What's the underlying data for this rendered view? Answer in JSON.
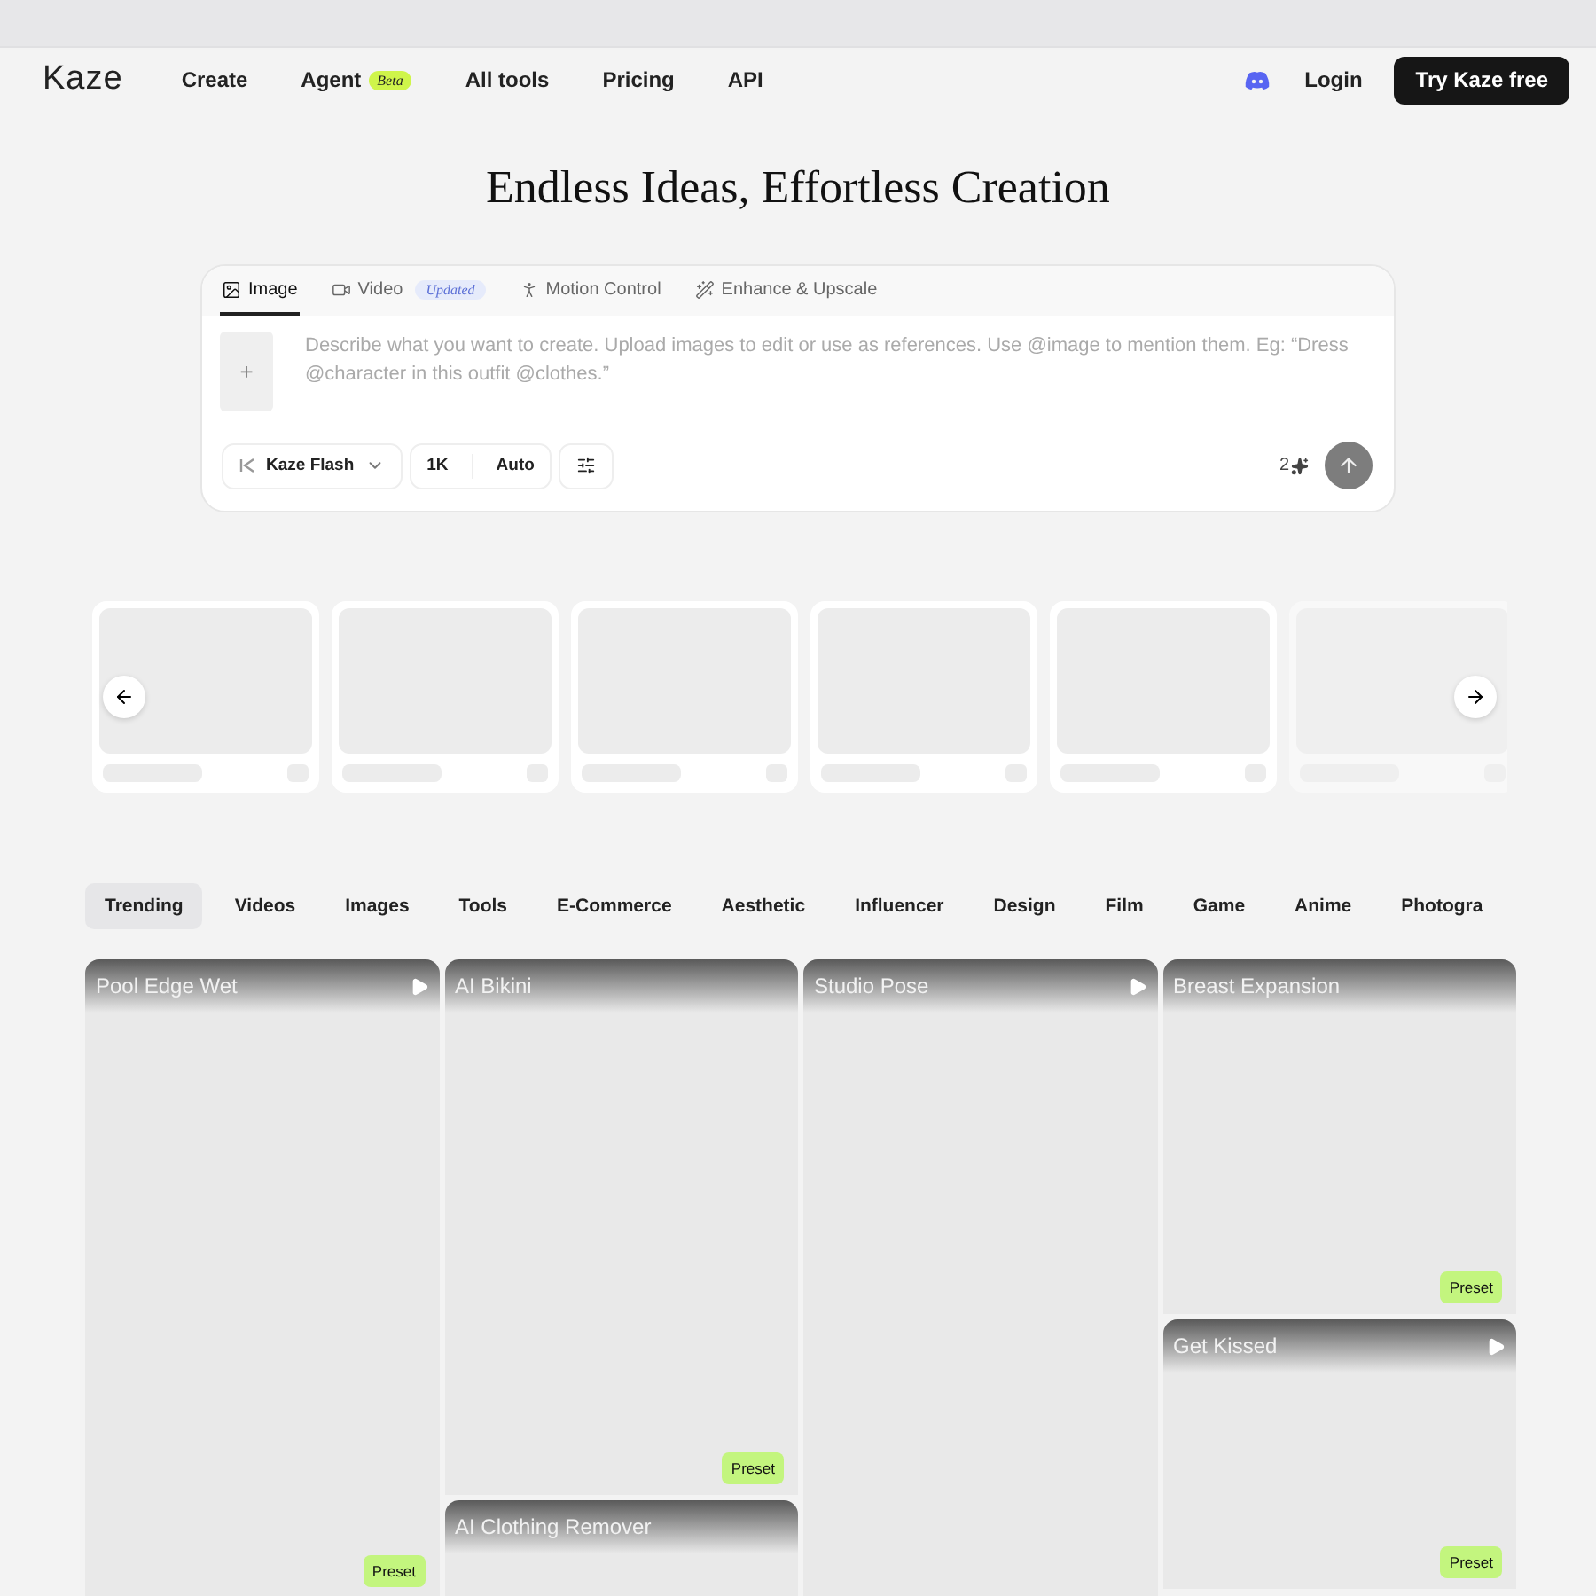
{
  "nav": {
    "logo": "Kaze",
    "links": [
      {
        "label": "Create"
      },
      {
        "label": "Agent",
        "badge": "Beta"
      },
      {
        "label": "All tools"
      },
      {
        "label": "Pricing"
      },
      {
        "label": "API"
      }
    ],
    "login": "Login",
    "cta": "Try Kaze free"
  },
  "headline": "Endless Ideas, Effortless Creation",
  "composer": {
    "tabs": [
      {
        "kind": "image",
        "label": "Image",
        "selected": true
      },
      {
        "kind": "video",
        "label": "Video",
        "badge": "Updated",
        "selected": false
      },
      {
        "kind": "motion",
        "label": "Motion Control",
        "selected": false
      },
      {
        "kind": "enhance",
        "label": "Enhance & Upscale",
        "selected": false
      }
    ],
    "add": "+",
    "placeholder": "Describe what you want to create. Upload images to edit or use as references. Use @image to mention them. Eg: “Dress @character in this outfit @clothes.”",
    "model": "Kaze Flash",
    "resolution": "1K",
    "ratio": "Auto",
    "count": "2"
  },
  "categories": [
    {
      "label": "Trending",
      "selected": true
    },
    {
      "label": "Videos",
      "selected": false
    },
    {
      "label": "Images",
      "selected": false
    },
    {
      "label": "Tools",
      "selected": false
    },
    {
      "label": "E-Commerce",
      "selected": false
    },
    {
      "label": "Aesthetic",
      "selected": false
    },
    {
      "label": "Influencer",
      "selected": false
    },
    {
      "label": "Design",
      "selected": false
    },
    {
      "label": "Film",
      "selected": false
    },
    {
      "label": "Game",
      "selected": false
    },
    {
      "label": "Anime",
      "selected": false
    },
    {
      "label": "Photogra",
      "selected": false
    }
  ],
  "columns": [
    [
      {
        "title": "Pool Edge Wet",
        "video": true,
        "preset": "Preset"
      }
    ],
    [
      {
        "title": "AI Bikini",
        "video": false,
        "preset": "Preset"
      },
      {
        "title": "AI Clothing Remover",
        "video": false
      }
    ],
    [
      {
        "title": "Studio Pose",
        "video": true
      }
    ],
    [
      {
        "title": "Breast Expansion",
        "video": false,
        "preset": "Preset"
      },
      {
        "title": "Get Kissed",
        "video": true,
        "preset": "Preset"
      }
    ]
  ]
}
